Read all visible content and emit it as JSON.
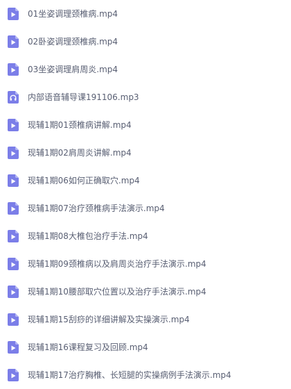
{
  "files": [
    {
      "name": "01坐姿调理颈椎病.mp4",
      "type": "video"
    },
    {
      "name": "02卧姿调理颈椎病.mp4",
      "type": "video"
    },
    {
      "name": "03坐姿调理肩周炎.mp4",
      "type": "video"
    },
    {
      "name": "内部语音辅导课191106.mp3",
      "type": "audio"
    },
    {
      "name": "现辅1期01颈椎病讲解.mp4",
      "type": "video"
    },
    {
      "name": "现辅1期02肩周炎讲解.mp4",
      "type": "video"
    },
    {
      "name": "现辅1期06如何正确取穴.mp4",
      "type": "video"
    },
    {
      "name": "现辅1期07治疗颈椎病手法演示.mp4",
      "type": "video"
    },
    {
      "name": "现辅1期08大椎包治疗手法.mp4",
      "type": "video"
    },
    {
      "name": "现辅1期09颈椎病以及肩周炎治疗手法演示.mp4",
      "type": "video"
    },
    {
      "name": "现辅1期10腰部取穴位置以及治疗手法演示.mp4",
      "type": "video"
    },
    {
      "name": "现辅1期15刮痧的详细讲解及实操演示.mp4",
      "type": "video"
    },
    {
      "name": "现辅1期16课程复习及回顾.mp4",
      "type": "video"
    },
    {
      "name": "现辅1期17治疗胸椎、长短腿的实操病例手法演示.mp4",
      "type": "video"
    }
  ],
  "icons": {
    "video": "video-file-icon",
    "audio": "audio-file-icon"
  },
  "colors": {
    "icon_fill": "#7b7ee8",
    "icon_fold": "#b3b5f4",
    "text": "#595f73"
  }
}
